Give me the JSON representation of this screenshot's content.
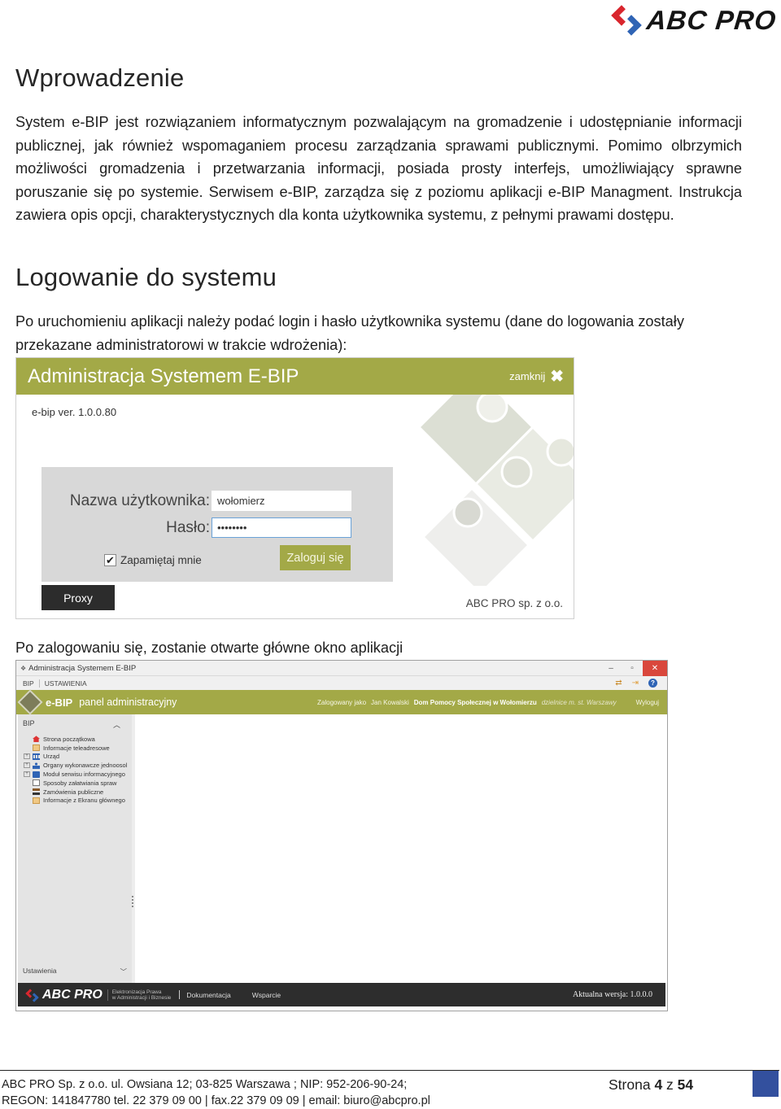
{
  "brand": {
    "name": "ABC PRO",
    "colors": {
      "red": "#d9262e",
      "blue": "#2f64b5"
    }
  },
  "intro": {
    "heading": "Wprowadzenie",
    "lines": [
      "System e-BIP jest rozwiązaniem informatycznym pozwalającym na gromadzenie i udostępnianie informacji",
      "publicznej, jak również wspomaganiem procesu zarządzania sprawami publicznymi. Pomimo olbrzymich",
      "możliwości gromadzenia i przetwarzania informacji, posiada prosty interfejs, umożliwiający sprawne",
      "poruszanie się po systemie. Serwisem e-BIP, zarządza się z poziomu aplikacji e-BIP Managment. Instrukcja",
      "zawiera opis opcji, charakterystycznych dla konta użytkownika systemu, z pełnymi prawami dostępu."
    ]
  },
  "login_section": {
    "heading": "Logowanie do systemu",
    "lines": [
      "Po uruchomieniu aplikacji należy podać login i hasło użytkownika systemu (dane do logowania zostały",
      "przekazane administratorowi w trakcie wdrożenia):"
    ]
  },
  "login_window": {
    "title": "Administracja Systemem E-BIP",
    "close_label": "zamknij",
    "close_icon": "✖",
    "version": "e-bip ver. 1.0.0.80",
    "username_label": "Nazwa użytkownika:",
    "username_value": "wołomierz",
    "password_label": "Hasło:",
    "password_value": "••••••••",
    "remember_label": "Zapamiętaj mnie",
    "remember_checked": true,
    "check_glyph": "✔",
    "submit_label": "Zaloguj się",
    "proxy_label": "Proxy",
    "company": "ABC PRO sp. z o.o.",
    "accent_color": "#a3a947"
  },
  "after_login_text": "Po zalogowaniu się, zostanie otwarte główne okno aplikacji",
  "app_window": {
    "title": "Administracja Systemem E-BIP",
    "controls": {
      "minimize": "–",
      "maximize": "▫",
      "close": "✕"
    },
    "menus": [
      "BIP",
      "USTAWIENIA"
    ],
    "toolbar_icons": [
      "sync-icon",
      "export-icon",
      "help-icon"
    ],
    "toolbar_glyphs": [
      "⇄",
      "⇥",
      "?"
    ],
    "banner": {
      "brand_bold": "e-BIP",
      "brand_rest": "panel administracyjny",
      "logged_as_label": "Zalogowany jako",
      "user": "Jan Kowalski",
      "organization": "Dom Pomocy Społecznej w Wołomierzu",
      "district": "dzielnice m. st. Warszawy",
      "logout": "Wyloguj"
    },
    "sidebar": {
      "header": "BIP",
      "collapse_glyph": "︿",
      "items": [
        {
          "label": "Strona początkowa",
          "expandable": false,
          "icon": "home-icon",
          "color": "#d33"
        },
        {
          "label": "Informacje teleadresowe",
          "expandable": false,
          "icon": "contact-icon",
          "color": "#e8b860"
        },
        {
          "label": "Urząd",
          "expandable": true,
          "icon": "building-icon",
          "color": "#2f64b5"
        },
        {
          "label": "Organy wykonawcze jednoosol",
          "expandable": true,
          "icon": "person-icon",
          "color": "#2f64b5"
        },
        {
          "label": "Moduł serwisu informacyjnego",
          "expandable": true,
          "icon": "info-module-icon",
          "color": "#2f64b5"
        },
        {
          "label": "Sposoby załatwiania spraw",
          "expandable": false,
          "icon": "document-icon",
          "color": "#777"
        },
        {
          "label": "Zamówienia publiczne",
          "expandable": false,
          "icon": "gavel-icon",
          "color": "#8a5a2a"
        },
        {
          "label": "Informacje z Ekranu głównego",
          "expandable": false,
          "icon": "contact-icon",
          "color": "#e8b860"
        }
      ],
      "footer": "Ustawienia",
      "footer_glyph": "﹀"
    },
    "footer": {
      "logo": "ABC PRO",
      "tagline_1": "Elektronizacja Prawa",
      "tagline_2": "w Administracji i Biznesie",
      "links": [
        "Dokumentacja",
        "Wsparcie"
      ],
      "version": "Aktualna wersja: 1.0.0.0"
    }
  },
  "page_footer": {
    "line1": "ABC PRO Sp. z o.o. ul. Owsiana 12;  03-825 Warszawa ; NIP: 952-206-90-24;",
    "line2": "REGON: 141847780 tel. 22 379 09 00 | fax.22 379 09 09 | email: biuro@abcpro.pl",
    "page_label": "Strona",
    "page_current": "4",
    "page_of": "z",
    "page_total": "54",
    "accent_color": "#33509e"
  }
}
